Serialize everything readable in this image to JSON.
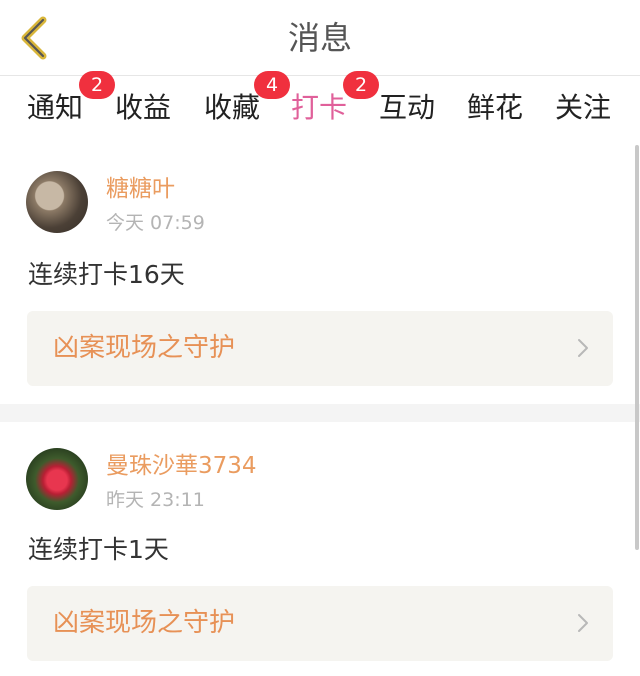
{
  "header": {
    "title": "消息"
  },
  "tabs": [
    {
      "label": "通知",
      "badge": "2"
    },
    {
      "label": "收益",
      "badge": ""
    },
    {
      "label": "收藏",
      "badge": "4"
    },
    {
      "label": "打卡",
      "badge": "2",
      "active": true
    },
    {
      "label": "互动",
      "badge": ""
    },
    {
      "label": "鲜花",
      "badge": ""
    },
    {
      "label": "关注",
      "badge": ""
    }
  ],
  "feed": [
    {
      "username": "糖糖叶",
      "time": "今天 07:59",
      "message": "连续打卡16天",
      "book_title": "凶案现场之守护"
    },
    {
      "username": "曼珠沙華3734",
      "time": "昨天 23:11",
      "message": "连续打卡1天",
      "book_title": "凶案现场之守护"
    }
  ],
  "colors": {
    "accent": "#e0609a",
    "username": "#ea9c60",
    "badge": "#f0303e",
    "book_title": "#e79156"
  },
  "icons": {
    "back": "chevron-left-icon",
    "book_link": "chevron-right-icon"
  }
}
